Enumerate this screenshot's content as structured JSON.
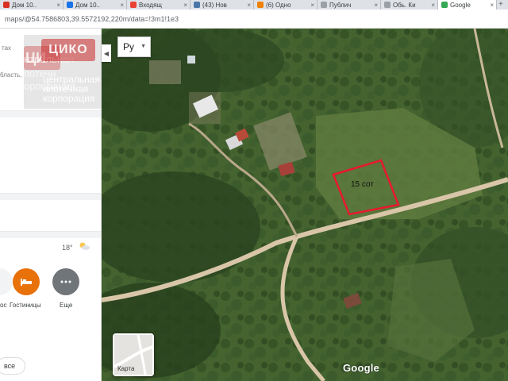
{
  "browser": {
    "tabs": [
      {
        "label": "Дом 10..",
        "favicon_color": "#d93025"
      },
      {
        "label": "Дом 10..",
        "favicon_color": "#1a73e8"
      },
      {
        "label": "Входящ",
        "favicon_color": "#ea4335"
      },
      {
        "label": "(43) Нов",
        "favicon_color": "#4a76a8"
      },
      {
        "label": "(6) Одно",
        "favicon_color": "#ee8208"
      },
      {
        "label": "Публич",
        "favicon_color": "#9aa0a6"
      },
      {
        "label": "Обь. Ки",
        "favicon_color": "#9aa0a6"
      },
      {
        "label": "Google",
        "favicon_color": "#34a853"
      }
    ],
    "new_tab_label": "+",
    "url": "maps/@54.7586803,39.5572192,220m/data=!3m1!1e3"
  },
  "map": {
    "language_select": "Ру",
    "plot_label": "15 сот",
    "map_type_label": "Карта",
    "attribution": "Google"
  },
  "left_panel": {
    "temperature": "18°",
    "categories": [
      {
        "label": "ос",
        "color": "#ffffff",
        "icon": "partial-icon"
      },
      {
        "label": "Гостиницы",
        "color": "#e8710a",
        "icon": "bed-icon"
      },
      {
        "label": "Еще",
        "color": "#70757a",
        "icon": "more-icon"
      }
    ],
    "all_label": "все",
    "snippet_top": "тах",
    "snippet_mid": "бласть,"
  },
  "watermark": {
    "logo": "ЦИКО",
    "ghost_logo": "ЦИ",
    "line1": "центральная",
    "line2": "ипотечная",
    "line3": "корпорация",
    "ghost_line1": "нтральная",
    "ghost_line2": "потечн",
    "ghost_line3": "орпорация"
  },
  "colors": {
    "accent_plot": "#e8192c",
    "road": "#d9c6a8",
    "hotel": "#e8710a",
    "more": "#70757a"
  }
}
